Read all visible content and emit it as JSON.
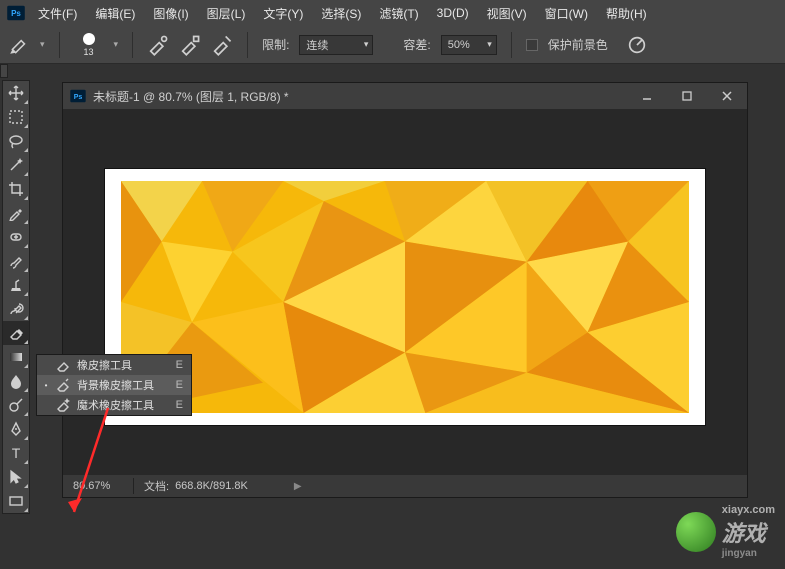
{
  "menubar": {
    "items": [
      {
        "label": "文件(F)"
      },
      {
        "label": "编辑(E)"
      },
      {
        "label": "图像(I)"
      },
      {
        "label": "图层(L)"
      },
      {
        "label": "文字(Y)"
      },
      {
        "label": "选择(S)"
      },
      {
        "label": "滤镜(T)"
      },
      {
        "label": "3D(D)"
      },
      {
        "label": "视图(V)"
      },
      {
        "label": "窗口(W)"
      },
      {
        "label": "帮助(H)"
      }
    ]
  },
  "options": {
    "brush_size": "13",
    "limit_label": "限制:",
    "limit_value": "连续",
    "tolerance_label": "容差:",
    "tolerance_value": "50%",
    "protect_fg_label": "保护前景色"
  },
  "document": {
    "title": "未标题-1 @ 80.7% (图层 1, RGB/8) *",
    "zoom": "80.67%",
    "docinfo_label": "文档:",
    "docinfo_value": "668.8K/891.8K"
  },
  "flyout": {
    "items": [
      {
        "label": "橡皮擦工具",
        "key": "E",
        "selected": false
      },
      {
        "label": "背景橡皮擦工具",
        "key": "E",
        "selected": true
      },
      {
        "label": "魔术橡皮擦工具",
        "key": "E",
        "selected": false
      }
    ]
  },
  "watermark": {
    "site": "xiayx.com",
    "brand": "游戏",
    "sub": "jingyan"
  }
}
